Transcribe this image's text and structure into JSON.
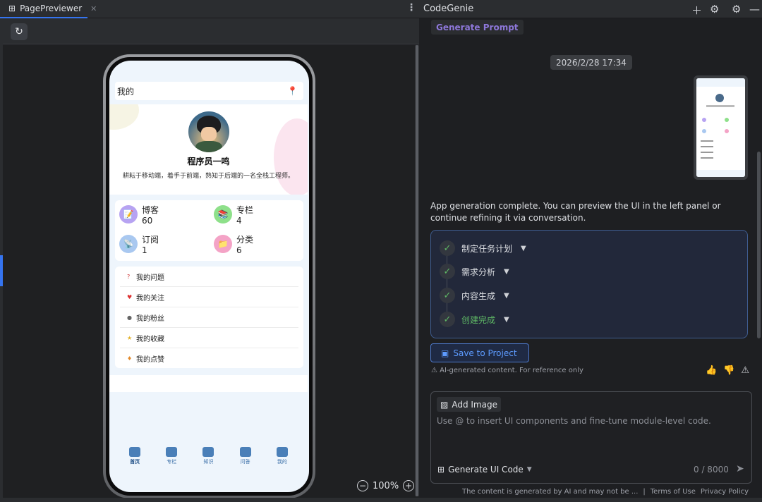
{
  "window": {
    "left_tab": "PagePreviewer",
    "right_title": "CodeGenie"
  },
  "preview": {
    "zoom": "100%",
    "app": {
      "header_title": "我的",
      "profile": {
        "name": "程序员一鸣",
        "bio": "耕耘于移动端，着手于前端，熟知于后端的一名全栈工程师。"
      },
      "stats": [
        {
          "label": "博客",
          "value": "60",
          "color": "#b7a3f2"
        },
        {
          "label": "专栏",
          "value": "4",
          "color": "#8ee08a"
        },
        {
          "label": "订阅",
          "value": "1",
          "color": "#a9c8f0"
        },
        {
          "label": "分类",
          "value": "6",
          "color": "#f4a3c6"
        }
      ],
      "menu": [
        {
          "label": "我的问题",
          "icon": "question-icon"
        },
        {
          "label": "我的关注",
          "icon": "heart-icon"
        },
        {
          "label": "我的粉丝",
          "icon": "person-icon"
        },
        {
          "label": "我的收藏",
          "icon": "star-icon"
        },
        {
          "label": "我的点赞",
          "icon": "thumb-icon"
        }
      ],
      "tabs": [
        "首页",
        "专栏",
        "知识",
        "问答",
        "我的"
      ]
    }
  },
  "chat": {
    "generate_prompt": "Generate Prompt",
    "timestamp": "2026/2/28 17:34",
    "message": "App generation complete. You can preview the UI in the left panel or continue refining it via conversation.",
    "steps": [
      {
        "label": "制定任务计划"
      },
      {
        "label": "需求分析"
      },
      {
        "label": "内容生成"
      },
      {
        "label": "创建完成"
      }
    ],
    "save_button": "Save to Project",
    "disclaimer": "AI-generated content. For reference only",
    "input": {
      "add_image": "Add Image",
      "placeholder": "Use @ to insert UI components and fine-tune module-level code.",
      "mode": "Generate UI Code",
      "counter": "0 / 8000"
    },
    "footer": {
      "note": "The content is generated by AI and may not be ...",
      "terms": "Terms of Use",
      "privacy": "Privacy Policy"
    }
  },
  "colors": {
    "accent": "#3574f0",
    "success": "#5fb865",
    "prompt": "#8d77d9"
  }
}
